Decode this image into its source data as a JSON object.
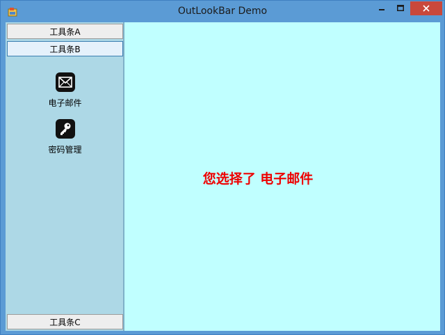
{
  "window": {
    "title": "OutLookBar Demo"
  },
  "outlookbar": {
    "groups": [
      {
        "label": "工具条A"
      },
      {
        "label": "工具条B"
      },
      {
        "label": "工具条C"
      }
    ],
    "items": [
      {
        "label": "电子邮件",
        "icon": "envelope-icon"
      },
      {
        "label": "密码管理",
        "icon": "key-icon"
      }
    ]
  },
  "main": {
    "message": "您选择了 电子邮件"
  },
  "colors": {
    "titlebar": "#5b9bd5",
    "sidebar": "#add8e6",
    "content": "#c0ffff",
    "message": "#ee0000",
    "close_button": "#c9483b"
  }
}
